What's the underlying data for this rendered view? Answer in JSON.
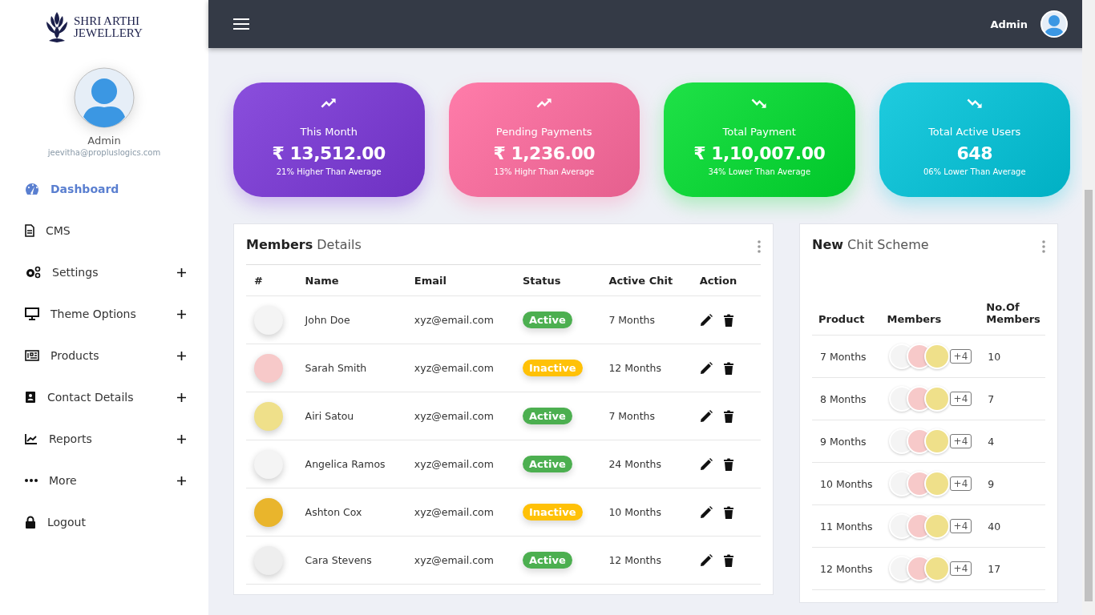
{
  "brand": {
    "line_1": "SHRI ARTHI",
    "line_2": "JEWELLERY"
  },
  "profile": {
    "name": "Admin",
    "email": "jeevitha@propluslogics.com"
  },
  "sidebar": {
    "items": [
      {
        "label": "Dashboard",
        "selected": true,
        "expandable": false
      },
      {
        "label": "CMS",
        "selected": false,
        "expandable": false
      },
      {
        "label": "Settings",
        "selected": false,
        "expandable": true
      },
      {
        "label": "Theme Options",
        "selected": false,
        "expandable": true
      },
      {
        "label": "Products",
        "selected": false,
        "expandable": true
      },
      {
        "label": "Contact Details",
        "selected": false,
        "expandable": true
      },
      {
        "label": "Reports",
        "selected": false,
        "expandable": true
      },
      {
        "label": "More",
        "selected": false,
        "expandable": true
      },
      {
        "label": "Logout",
        "selected": false,
        "expandable": false
      }
    ]
  },
  "topbar": {
    "user": "Admin"
  },
  "stats": [
    {
      "title": "This Month",
      "value": "₹ 13,512.00",
      "note": "21% Higher Than Average",
      "kind": "up",
      "color": "#7a36d8"
    },
    {
      "title": "Pending Payments",
      "value": "₹ 1,236.00",
      "note": "13% Highr Than Average",
      "kind": "up",
      "color": "#ff6a9e"
    },
    {
      "title": "Total Payment",
      "value": "₹ 1,10,007.00",
      "note": "34% Lower Than Average",
      "kind": "down",
      "color": "#00dd2e"
    },
    {
      "title": "Total Active Users",
      "value": "648",
      "note": "06% Lower Than Average",
      "kind": "down",
      "color": "#00c4da"
    }
  ],
  "members": {
    "title_bold": "Members",
    "title_rest": "Details",
    "columns": [
      "#",
      "Name",
      "Email",
      "Status",
      "Active Chit",
      "Action"
    ],
    "rows": [
      {
        "name": "John Doe",
        "email": "xyz@email.com",
        "status": "Active",
        "kind": "active",
        "chit": "7 Months"
      },
      {
        "name": "Sarah Smith",
        "email": "xyz@email.com",
        "status": "Inactive",
        "kind": "inactive",
        "chit": "12 Months"
      },
      {
        "name": "Airi Satou",
        "email": "xyz@email.com",
        "status": "Active",
        "kind": "active",
        "chit": "7 Months"
      },
      {
        "name": "Angelica Ramos",
        "email": "xyz@email.com",
        "status": "Active",
        "kind": "active",
        "chit": "24 Months"
      },
      {
        "name": "Ashton Cox",
        "email": "xyz@email.com",
        "status": "Inactive",
        "kind": "inactive",
        "chit": "10 Months"
      },
      {
        "name": "Cara Stevens",
        "email": "xyz@email.com",
        "status": "Active",
        "kind": "active",
        "chit": "12 Months"
      }
    ]
  },
  "chit": {
    "title_bold": "New",
    "title_rest": "Chit Scheme",
    "columns": [
      "Product",
      "Members",
      "No.Of Members"
    ],
    "rows": [
      {
        "product": "7 Months",
        "extra": "+4",
        "count": "10"
      },
      {
        "product": "8 Months",
        "extra": "+4",
        "count": "7"
      },
      {
        "product": "9 Months",
        "extra": "+4",
        "count": "4"
      },
      {
        "product": "10 Months",
        "extra": "+4",
        "count": "9"
      },
      {
        "product": "11 Months",
        "extra": "+4",
        "count": "40"
      },
      {
        "product": "12 Months",
        "extra": "+4",
        "count": "17"
      }
    ]
  }
}
